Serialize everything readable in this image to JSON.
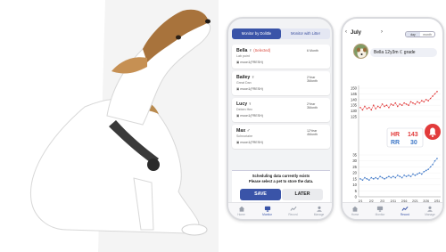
{
  "phone1": {
    "tabs": [
      {
        "label": "Monitor by Dolittle",
        "active": true
      },
      {
        "label": "Monitor with Litter",
        "active": false
      }
    ],
    "pets": [
      {
        "name": "Bella",
        "selected_label": "(Selected)",
        "breed": "Lab point",
        "device": "moon1(FRESH)",
        "age": "6 Month"
      },
      {
        "name": "Bailey",
        "selected_label": "",
        "breed": "Great Dan",
        "device": "moon1(FRESH)",
        "age": "2Year 3Month"
      },
      {
        "name": "Lucy",
        "selected_label": "",
        "breed": "Deben Hex",
        "device": "moon1(FRESH)",
        "age": "2Year 3Month"
      },
      {
        "name": "Max",
        "selected_label": "",
        "breed": "Schnoriaire",
        "device": "moon1(FRESH)",
        "age": "12Year 4Month"
      }
    ],
    "modal": {
      "line1": "Scheduling data currently exists",
      "line2": "Please select a pet to store the data.",
      "save_label": "SAVE",
      "later_label": "LATER"
    },
    "nav": [
      {
        "label": "Home",
        "icon": "home-icon",
        "active": false
      },
      {
        "label": "Monitor",
        "icon": "monitor-icon",
        "active": true
      },
      {
        "label": "Record",
        "icon": "record-icon",
        "active": false
      },
      {
        "label": "Manage",
        "icon": "manage-icon",
        "active": false
      }
    ]
  },
  "phone2": {
    "month": "July",
    "prev_icon": "chevron-left-icon",
    "next_icon": "chevron-right-icon",
    "toggle": [
      {
        "label": "day",
        "active": true
      },
      {
        "label": "month",
        "active": false
      }
    ],
    "pet_info": "Bella   12y3m   ℂ grade",
    "nav": [
      {
        "label": "Home",
        "icon": "home-icon",
        "active": false
      },
      {
        "label": "Monitor",
        "icon": "monitor-icon",
        "active": false
      },
      {
        "label": "Record",
        "icon": "record-icon",
        "active": true
      },
      {
        "label": "Manage",
        "icon": "manage-icon",
        "active": false
      }
    ]
  },
  "chart_data": {
    "type": "line",
    "categories": [
      "2/1",
      "2/2",
      "2/3",
      "2/11",
      "2/16",
      "2/21",
      "2/26",
      "2/31"
    ],
    "yticks": [
      150,
      145,
      140,
      135,
      130,
      125,
      35,
      30,
      25,
      20,
      15,
      10,
      5,
      0
    ],
    "series": [
      {
        "name": "HR",
        "color": "#e23b3b",
        "values": [
          133,
          131,
          134,
          132,
          133,
          131,
          135,
          132,
          134,
          133,
          136,
          134,
          135,
          133,
          136,
          135,
          137,
          134,
          136,
          135,
          137,
          136,
          135,
          138,
          137,
          136,
          138,
          137,
          139,
          138,
          140,
          139,
          141,
          143,
          145,
          147
        ]
      },
      {
        "name": "RR",
        "color": "#3f78c8",
        "values": [
          15,
          14,
          16,
          15,
          14,
          16,
          15,
          16,
          15,
          17,
          16,
          15,
          16,
          17,
          16,
          17,
          16,
          18,
          17,
          16,
          18,
          17,
          18,
          17,
          19,
          18,
          19,
          20,
          19,
          21,
          22,
          23,
          25,
          27,
          30,
          32
        ]
      }
    ],
    "readout": {
      "hr_label": "HR",
      "hr_value": "143",
      "rr_label": "RR",
      "rr_value": "30"
    },
    "alert_icon": "bell-alert-icon"
  }
}
